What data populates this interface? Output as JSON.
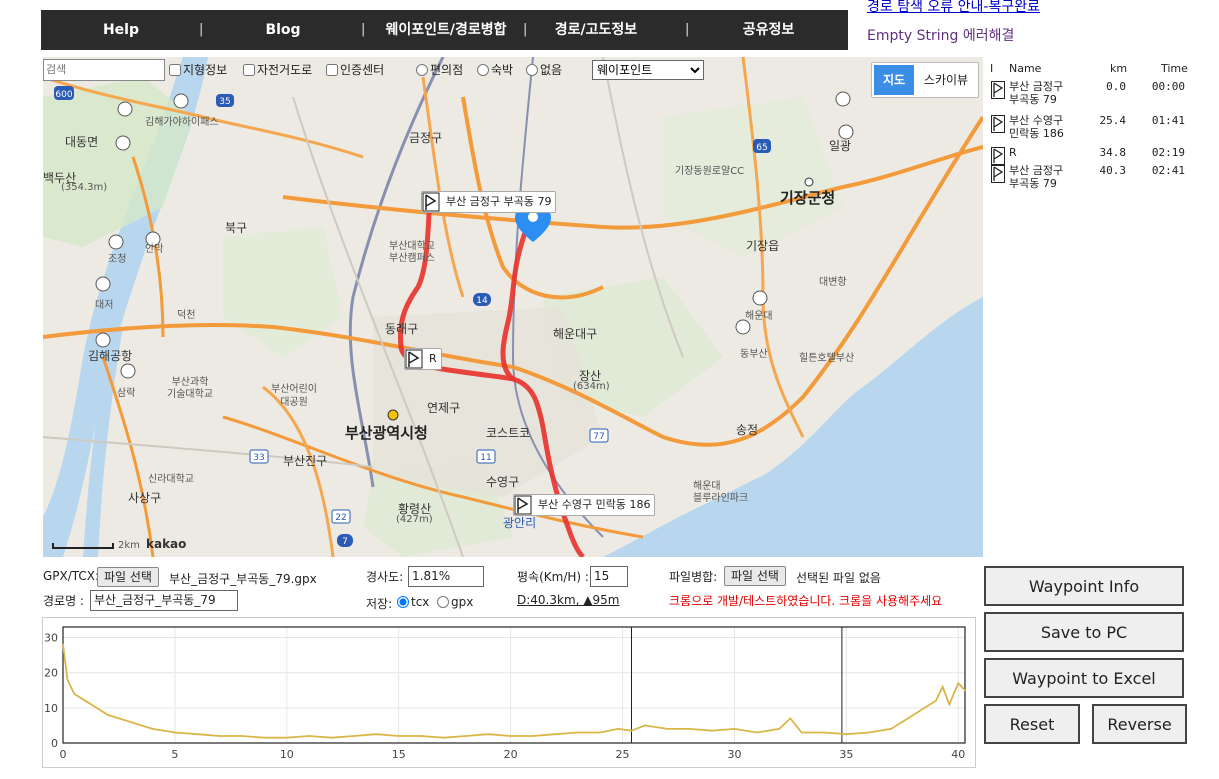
{
  "nav": {
    "items": [
      "Help",
      "Blog",
      "웨이포인트/경로병합",
      "경로/고도정보",
      "공유정보"
    ],
    "separator": "|"
  },
  "top_right": {
    "link": "경로 탐색 오류 안내-복구완료",
    "note": "Empty String 에러해결"
  },
  "map_toolbar": {
    "search_placeholder": "검색",
    "checkboxes": [
      "지형정보",
      "자전거도로",
      "인증센터"
    ],
    "radios": [
      "편의점",
      "숙박",
      "없음"
    ],
    "select_value": "웨이포인트",
    "map_type": [
      "지도",
      "스카이뷰"
    ]
  },
  "map": {
    "labels": {
      "geumjeong": "금정구",
      "buk": "북구",
      "dongrae": "동래구",
      "haeundae": "해운대구",
      "yeonje": "연제구",
      "suyeong": "수영구",
      "busanjin": "부산진구",
      "sasang": "사상구",
      "gijang_office": "기장군청",
      "gijang": "기장읍",
      "city_hall": "부산광역시청",
      "jangsan": "장산",
      "jangsan_h": "(634m)",
      "hwangnyeong": "황령산",
      "hwangnyeong_h": "(427m)",
      "baeksan": "백두산",
      "baeksan_h": "(354.3m)",
      "pnu": "부산대학교\n부산캠퍼스",
      "gimhae_airport": "김해공항",
      "daejeo": "대저",
      "songjeong": "송정",
      "ilgwang": "일광",
      "haeundae_ic": "해운대",
      "dongbusan": "동부산",
      "costco": "코스트코",
      "gwangalli": "광안리",
      "gijang_cc": "기장동원로얄CC",
      "deokcheon": "덕천",
      "hilton": "힐튼호텔부산",
      "daebyeon": "대변항",
      "gimhae_gaya": "김해가야하이패스",
      "daedong": "대동면",
      "children_park": "부산어린이\n대공원",
      "busan_science": "부산과학\n기술대학교",
      "silla": "신라대학교",
      "samnak": "삼락",
      "anmak": "안막",
      "jochung": "조청",
      "haeundae_blue": "해운대\n블루라인파크",
      "scale": "2km",
      "brand": "kakao"
    },
    "markers": [
      {
        "label": "부산 금정구 부곡동 79"
      },
      {
        "label": "R"
      },
      {
        "label": "부산 수영구 민락동 186"
      }
    ]
  },
  "waypoints": {
    "headers": [
      "I",
      "Name",
      "km",
      "Time"
    ],
    "rows": [
      {
        "name": "부산 금정구\n부곡동 79",
        "km": "0.0",
        "time": "00:00"
      },
      {
        "name": "부산 수영구\n민락동 186",
        "km": "25.4",
        "time": "01:41"
      },
      {
        "name": "R",
        "km": "34.8",
        "time": "02:19"
      },
      {
        "name": "부산 금정구\n부곡동 79",
        "km": "40.3",
        "time": "02:41"
      }
    ]
  },
  "controls": {
    "gpx_label": "GPX/TCX:",
    "file_button": "파일 선택",
    "file_name": "부산_금정구_부곡동_79.gpx",
    "route_label": "경로명 :",
    "route_name": "부산_금정구_부곡동_79",
    "slope_label": "경사도:",
    "slope_value": "1.81%",
    "save_label": "저장:",
    "save_options": [
      "tcx",
      "gpx"
    ],
    "speed_label": "평속(Km/H) :",
    "speed_value": "15",
    "distance_summary": "D:40.3km, ▲95m",
    "merge_label": "파일병합:",
    "merge_button": "파일 선택",
    "merge_status": "선택된 파일 없음",
    "notice": "크롬으로 개발/테스트하였습니다. 크롬을 사용해주세요"
  },
  "buttons": {
    "waypoint_info": "Waypoint Info",
    "save_pc": "Save to PC",
    "waypoint_excel": "Waypoint to Excel",
    "reset": "Reset",
    "reverse": "Reverse"
  },
  "chart_data": {
    "type": "area",
    "x_ticks": [
      0,
      5,
      10,
      15,
      20,
      25,
      30,
      35,
      40
    ],
    "y_ticks": [
      0,
      10,
      20,
      30
    ],
    "xlim": [
      0,
      40.3
    ],
    "ylim": [
      0,
      33
    ],
    "grid": true,
    "line_color": "#d9b64a",
    "markers_x": [
      25.4,
      34.8
    ],
    "x": [
      0,
      0.2,
      0.5,
      1,
      1.5,
      2,
      3,
      4,
      5,
      6,
      7,
      8,
      9,
      10,
      11,
      12,
      13,
      14,
      15,
      16,
      17,
      18,
      19,
      20,
      21,
      22,
      23,
      24,
      24.8,
      25.4,
      26,
      27,
      28,
      29,
      30,
      31,
      32,
      32.5,
      33,
      34,
      35,
      36,
      37,
      37.5,
      38,
      38.5,
      39,
      39.3,
      39.6,
      40,
      40.3
    ],
    "elevation": [
      28,
      18,
      14,
      12,
      10,
      8,
      6,
      4,
      3,
      2.5,
      2,
      2,
      1.5,
      1.5,
      2,
      1.5,
      2,
      2.5,
      2,
      2,
      1.5,
      2,
      2.5,
      2,
      2,
      2.5,
      3,
      3,
      4,
      3.5,
      5,
      4,
      4,
      3.5,
      4,
      3,
      4,
      7,
      3,
      3,
      2.5,
      3,
      4,
      6,
      8,
      10,
      12,
      16,
      11,
      17,
      15
    ]
  }
}
